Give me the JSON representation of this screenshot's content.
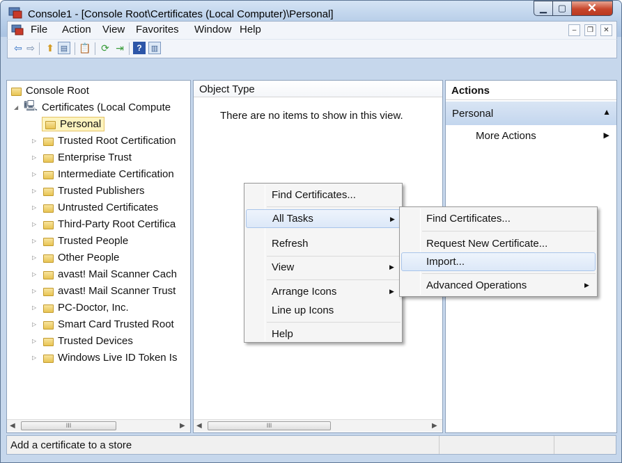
{
  "window": {
    "title": "Console1 - [Console Root\\Certificates (Local Computer)\\Personal]"
  },
  "menubar": {
    "items": [
      "File",
      "Action",
      "View",
      "Favorites",
      "Window",
      "Help"
    ]
  },
  "tree": {
    "root": "Console Root",
    "certificates": "Certificates (Local Compute",
    "items": [
      "Personal",
      "Trusted Root Certification",
      "Enterprise Trust",
      "Intermediate Certification",
      "Trusted Publishers",
      "Untrusted Certificates",
      "Third-Party Root Certifica",
      "Trusted People",
      "Other People",
      "avast! Mail Scanner Cach",
      "avast! Mail Scanner Trust",
      "PC-Doctor, Inc.",
      "Smart Card Trusted Root",
      "Trusted Devices",
      "Windows Live ID Token Is"
    ]
  },
  "list": {
    "header": "Object Type",
    "empty": "There are no items to show in this view."
  },
  "actions": {
    "header": "Actions",
    "section": "Personal",
    "more": "More Actions"
  },
  "context_menu": {
    "items": [
      "Find Certificates...",
      "All Tasks",
      "Refresh",
      "View",
      "Arrange Icons",
      "Line up Icons",
      "Help"
    ]
  },
  "submenu": {
    "items": [
      "Find Certificates...",
      "Request New Certificate...",
      "Import...",
      "Advanced Operations"
    ]
  },
  "status": {
    "text": "Add a certificate to a store"
  },
  "scroll_glyph": "III"
}
